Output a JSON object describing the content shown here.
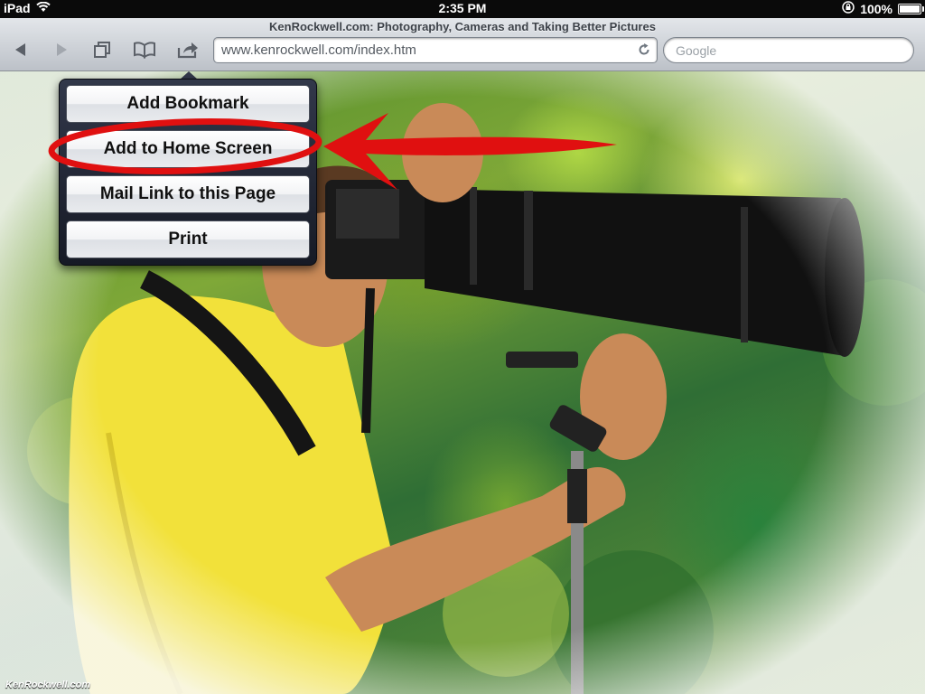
{
  "status_bar": {
    "device": "iPad",
    "time": "2:35 PM",
    "battery": "100%",
    "battery_level": 1.0
  },
  "browser": {
    "page_title": "KenRockwell.com: Photography, Cameras and Taking Better Pictures",
    "url": "www.kenrockwell.com/index.htm",
    "search_placeholder": "Google"
  },
  "share_menu": {
    "items": [
      {
        "label": "Add Bookmark"
      },
      {
        "label": "Add to Home Screen"
      },
      {
        "label": "Mail Link to this Page"
      },
      {
        "label": "Print"
      }
    ],
    "highlighted_item": "Add to Home Screen"
  },
  "watermark": "KenRockwell.com",
  "colors": {
    "annotation": "#e01010",
    "toolbar_top": "#e3e6ea",
    "toolbar_bottom": "#bcc1c8",
    "popover": "#232836"
  },
  "icons": [
    "wifi-icon",
    "lock-rotation-icon",
    "back-icon",
    "forward-icon",
    "pages-icon",
    "bookmarks-icon",
    "share-icon",
    "reload-icon"
  ]
}
